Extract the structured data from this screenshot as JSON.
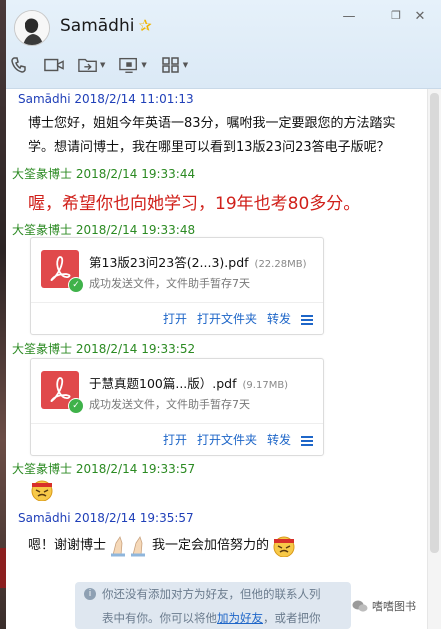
{
  "window": {
    "title": "Samādhi",
    "controls": [
      "minimize-icon",
      "restore-icon",
      "close-icon"
    ]
  },
  "toolbar": {
    "items": [
      "phone-icon",
      "video-icon",
      "forward-folder-icon",
      "screen-share-icon",
      "apps-grid-icon"
    ]
  },
  "messages": [
    {
      "sender": "Samādhi",
      "time": "2018/2/14 11:01:13",
      "text_line1": "博士您好，姐姐今年英语一83分，嘱咐我一定要跟您的方法踏实",
      "text_line2": "学。想请问博士，我在哪里可以看到13版23问23答电子版呢？"
    },
    {
      "sender": "大筌彖博士",
      "time": "2018/2/14 19:33:44",
      "text": "喔，希望你也向她学习，19年也考80多分。"
    },
    {
      "sender": "大筌彖博士",
      "time": "2018/2/14 19:33:48",
      "file": {
        "name": "第13版23问23答(2...3).pdf",
        "size": "(22.28MB)",
        "status": "成功发送文件，文件助手暂存7天",
        "actions": [
          "打开",
          "打开文件夹",
          "转发"
        ]
      }
    },
    {
      "sender": "大筌彖博士",
      "time": "2018/2/14 19:33:52",
      "file": {
        "name": "于慧真题100篇...版）.pdf",
        "size": "(9.17MB)",
        "status": "成功发送文件，文件助手暂存7天",
        "actions": [
          "打开",
          "打开文件夹",
          "转发"
        ]
      }
    },
    {
      "sender": "大筌彖博士",
      "time": "2018/2/14 19:33:57",
      "sticker": "determined-face-emoji"
    },
    {
      "sender": "Samādhi",
      "time": "2018/2/14 19:35:57",
      "text_a": "嗯！谢谢博士",
      "text_b": "我一定会加倍努力的"
    }
  ],
  "notice": {
    "line1": "你还没有添加对方为好友，但他的联系人列",
    "line2_a": "表中有你。你可以将他",
    "link": "加为好友",
    "line2_b": "，或者把你"
  },
  "watermark": "嗜嗜图书",
  "colors": {
    "self_name": "#1f3fb8",
    "other_name": "#2b8a22",
    "highlight_text": "#d0201a",
    "link": "#1e66c8"
  }
}
